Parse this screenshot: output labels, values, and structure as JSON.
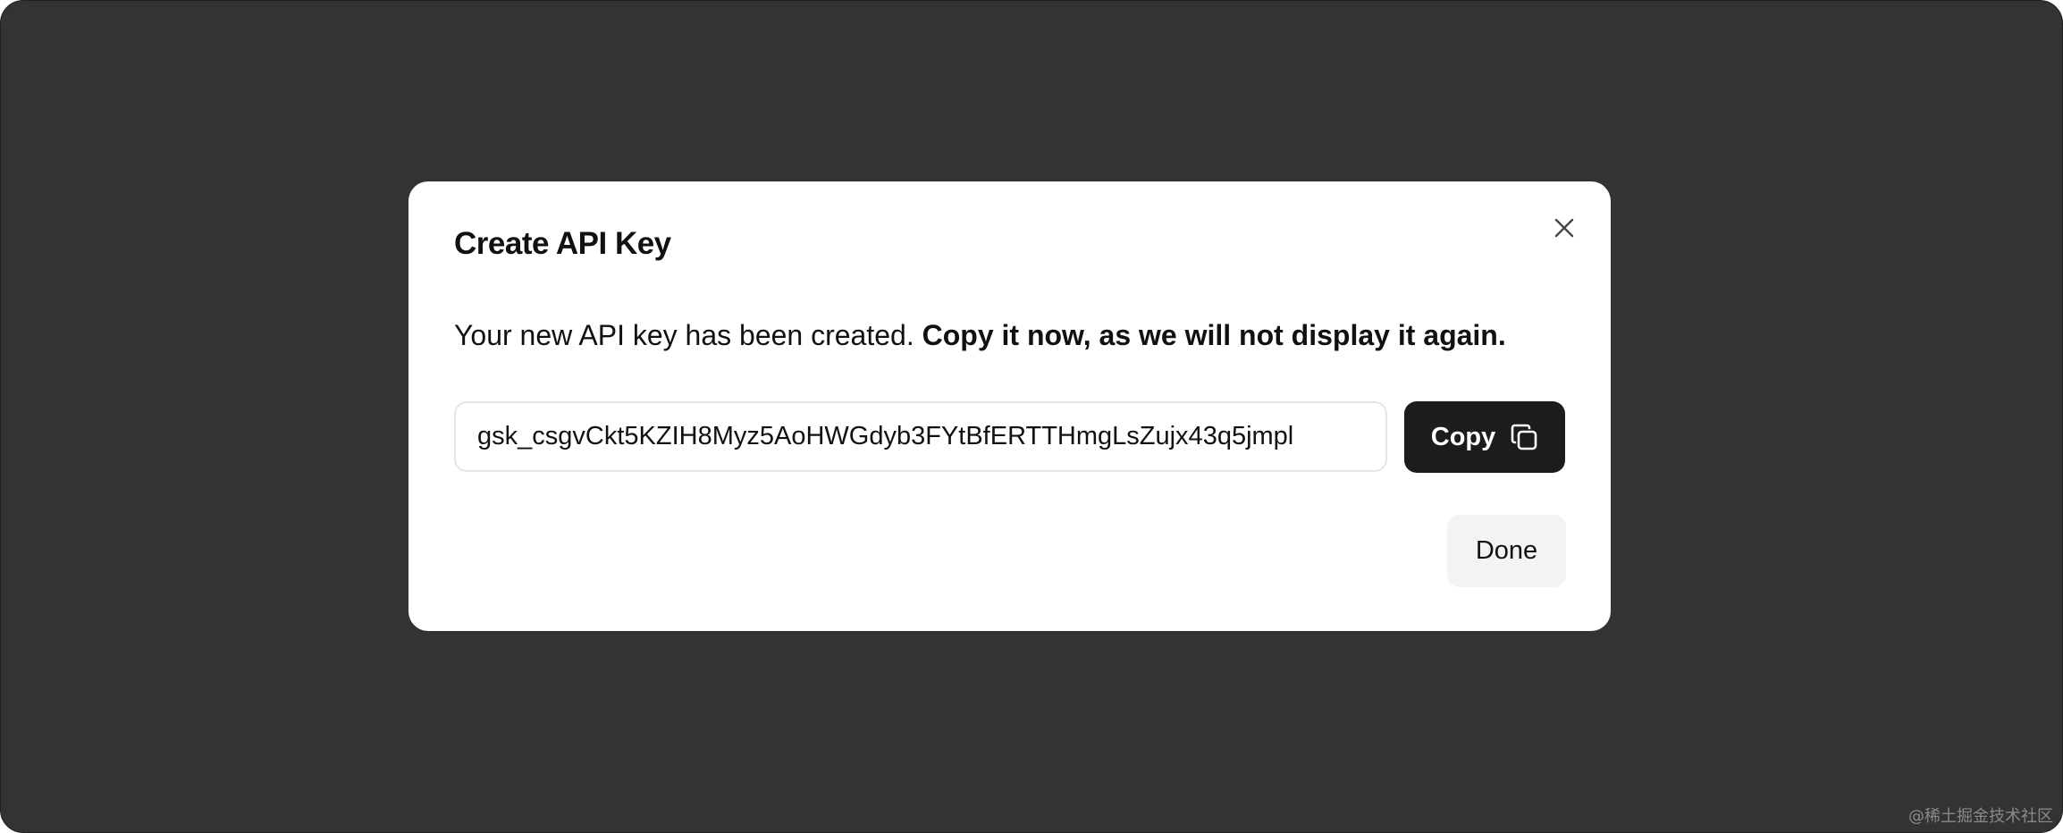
{
  "dialog": {
    "title": "Create API Key",
    "close_icon": "close-icon",
    "message_plain": "Your new API key has been created. ",
    "message_bold": "Copy it now, as we will not display it again.",
    "api_key_value": "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",
    "copy_label": "Copy",
    "copy_icon": "copy-icon",
    "done_label": "Done"
  },
  "watermark": "@稀土掘金技术社区",
  "colors": {
    "backdrop": "#333333",
    "modal_background": "#ffffff",
    "copy_button": "#1c1c1c",
    "done_button": "#f3f3f3",
    "text": "#111111"
  }
}
